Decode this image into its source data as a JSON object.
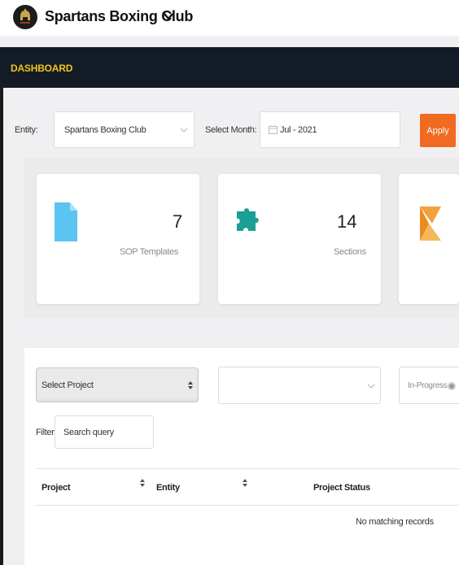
{
  "header": {
    "club_name": "Spartans Boxing Club"
  },
  "dashboard": {
    "title": "DASHBOARD"
  },
  "filters": {
    "entity_label": "Entity:",
    "entity_value": "Spartans Boxing Club",
    "month_label": "Select Month:",
    "month_value": "Jul - 2021",
    "apply_label": "Apply"
  },
  "stats": [
    {
      "value": "7",
      "label": "SOP Templates"
    },
    {
      "value": "14",
      "label": "Sections"
    },
    {
      "value": "",
      "label": ""
    }
  ],
  "projects": {
    "select_project": "Select Project",
    "status_toggle": "In-Progress",
    "filter_label": "Filter:",
    "search_placeholder": "Search query",
    "columns": [
      "Project",
      "Entity",
      "Project Status"
    ],
    "empty_message": "No matching records"
  },
  "colors": {
    "accent": "#f06a22",
    "dashboard_title": "#f0c419",
    "nav_bg": "#131c26"
  }
}
